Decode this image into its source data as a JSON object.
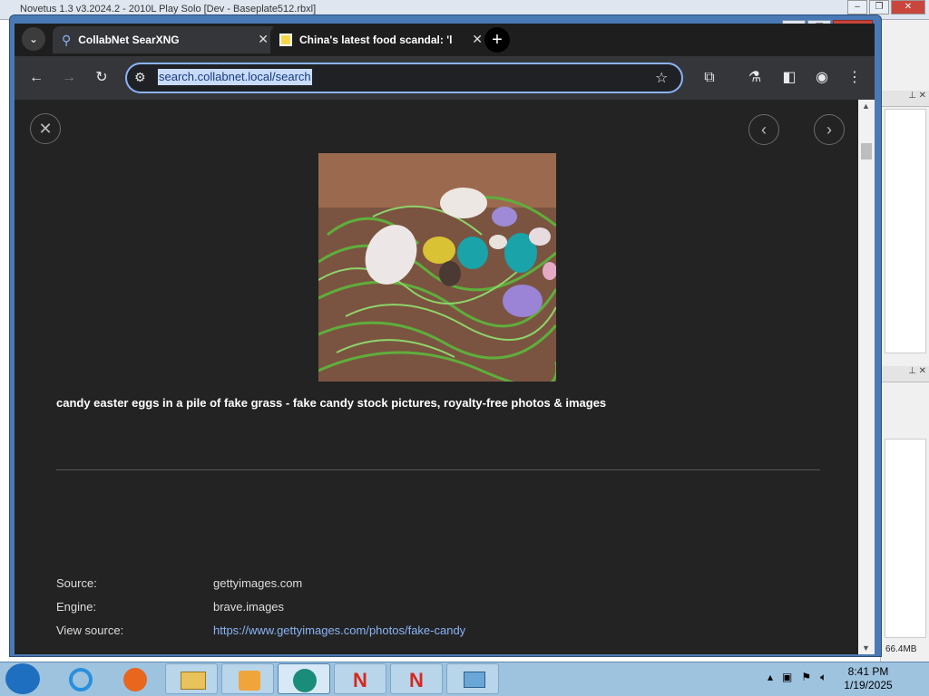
{
  "background_app": {
    "title": "Novetus 1.3 v3.2024.2 - 2010L Play Solo [Dev - Baseplate512.rbxl]",
    "memory": "66.4MB"
  },
  "browser": {
    "tabs": [
      {
        "label": "CollabNet SearXNG",
        "active": true
      },
      {
        "label": "China's latest food scandal: 'le",
        "active": false
      }
    ],
    "address": "search.collabnet.local/search"
  },
  "viewer": {
    "caption": "candy easter eggs in a pile of fake grass - fake candy stock pictures, royalty-free photos & images",
    "meta": [
      {
        "label": "Source:",
        "value": "gettyimages.com"
      },
      {
        "label": "Engine:",
        "value": "brave.images"
      },
      {
        "label": "View source:",
        "value": "https://www.gettyimages.com/photos/fake-candy"
      }
    ]
  },
  "taskbar": {
    "time": "8:41 PM",
    "date": "1/19/2025"
  },
  "colors": {
    "accent": "#8ab4f8",
    "page_bg": "#232323"
  }
}
